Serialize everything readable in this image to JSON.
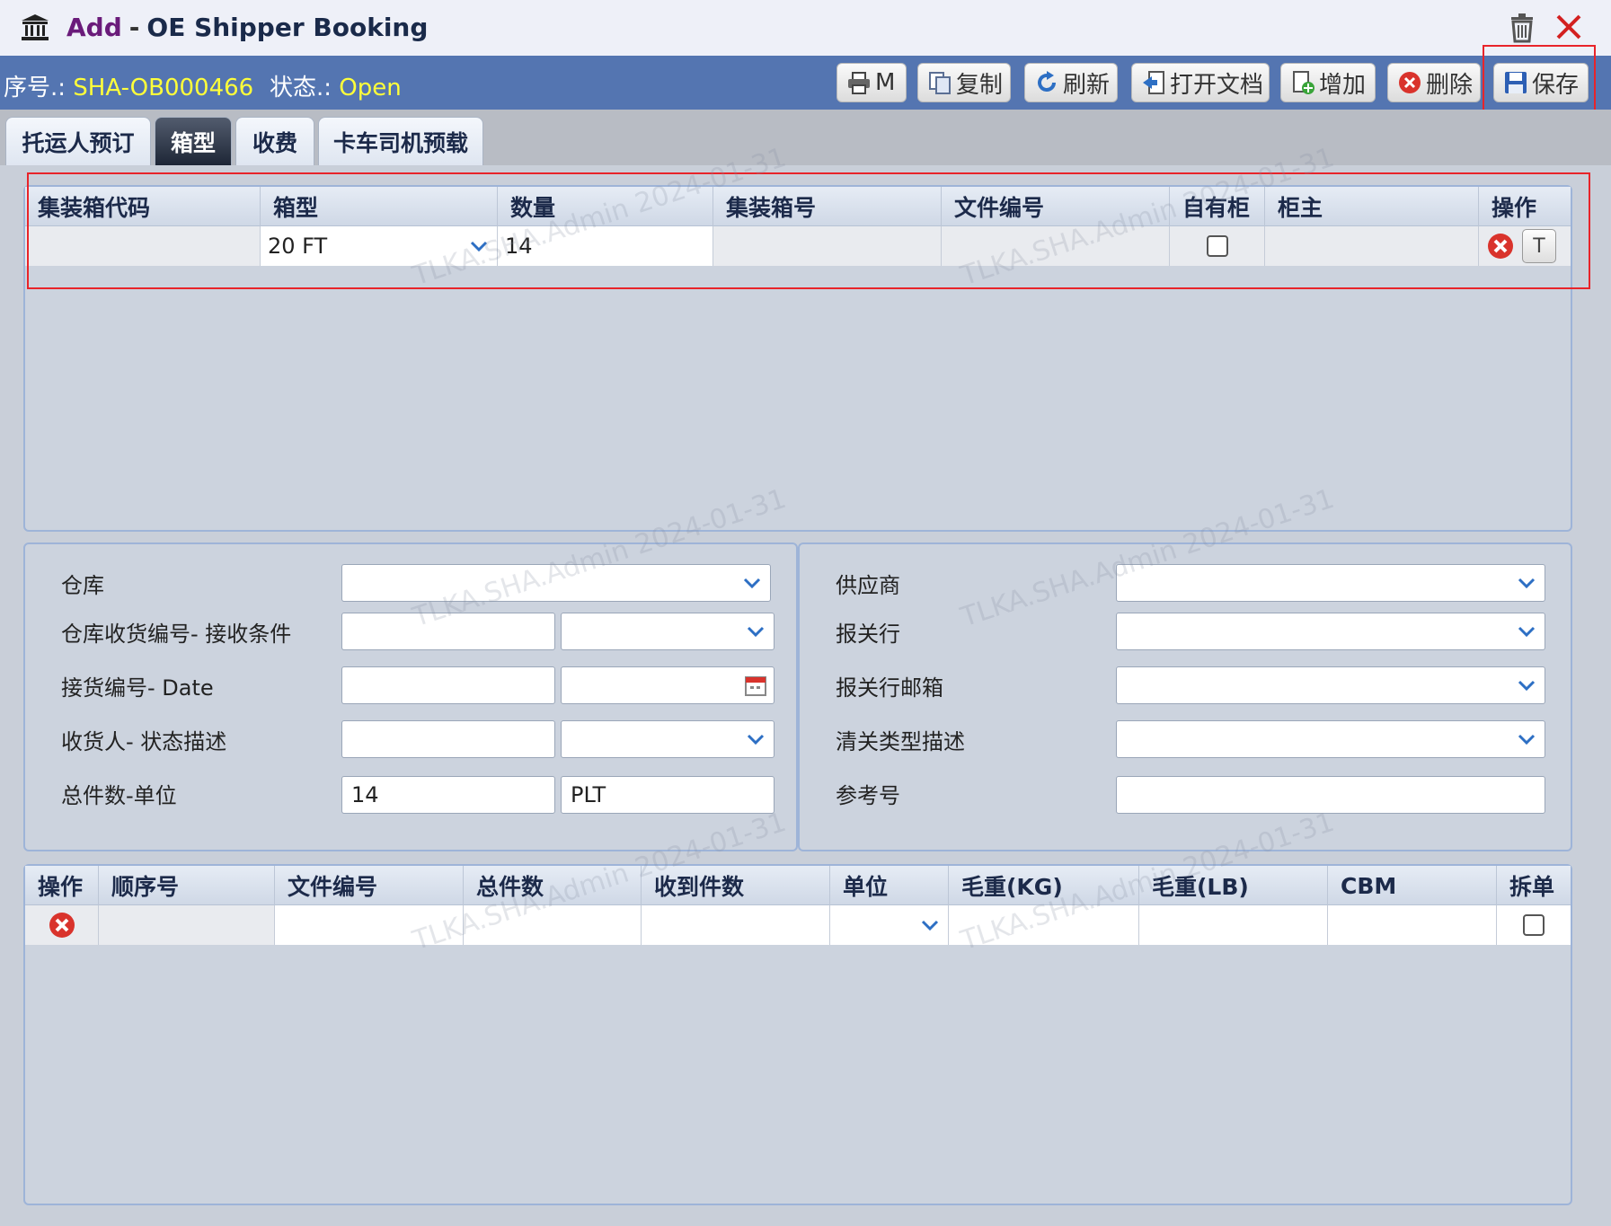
{
  "window": {
    "mode": "Add",
    "separator": "-",
    "title": "OE Shipper Booking"
  },
  "record": {
    "seq_label": "序号.:",
    "seq_value": "SHA-OB000466",
    "status_label": "状态.:",
    "status_value": "Open"
  },
  "toolbar": {
    "print_label": "M",
    "copy_label": "复制",
    "refresh_label": "刷新",
    "open_doc_label": "打开文档",
    "add_label": "增加",
    "delete_label": "删除",
    "save_label": "保存"
  },
  "tabs": [
    {
      "label": "托运人预订",
      "active": false
    },
    {
      "label": "箱型",
      "active": true
    },
    {
      "label": "收费",
      "active": false
    },
    {
      "label": "卡车司机预载",
      "active": false
    }
  ],
  "container_grid": {
    "columns": [
      "集装箱代码",
      "箱型",
      "数量",
      "集装箱号",
      "文件编号",
      "自有柜",
      "柜主",
      "操作"
    ],
    "rows": [
      {
        "container_code": "",
        "box_type": "20 FT",
        "quantity": "14",
        "container_no": "",
        "file_no": "",
        "own_container": false,
        "owner": "",
        "t_label": "T"
      }
    ]
  },
  "left_form": {
    "warehouse_label": "仓库",
    "warehouse_value": "",
    "receipt_label": "仓库收货编号- 接收条件",
    "receipt_no": "",
    "receipt_condition": "",
    "pickup_label": "接货编号- Date",
    "pickup_no": "",
    "pickup_date": "",
    "consignee_label": "收货人- 状态描述",
    "consignee": "",
    "status_desc": "",
    "total_label": "总件数-单位",
    "total_pieces": "14",
    "unit": "PLT"
  },
  "right_form": {
    "supplier_label": "供应商",
    "supplier_value": "",
    "broker_label": "报关行",
    "broker_value": "",
    "broker_email_label": "报关行邮箱",
    "broker_email_value": "",
    "clearance_label": "清关类型描述",
    "clearance_value": "",
    "ref_label": "参考号",
    "ref_value": ""
  },
  "cargo_grid": {
    "columns": [
      "操作",
      "顺序号",
      "文件编号",
      "总件数",
      "收到件数",
      "单位",
      "毛重(KG)",
      "毛重(LB)",
      "CBM",
      "拆单"
    ],
    "rows": [
      {
        "seq": "",
        "file_no": "",
        "total": "",
        "received": "",
        "unit": "",
        "gross_kg": "",
        "gross_lb": "",
        "cbm": "",
        "split": false
      }
    ]
  },
  "watermark_text": "TLKA.SHA.Admin 2024-01-31",
  "colors": {
    "toolbar_bg": "#5475b1",
    "status_yellow": "#ffff3a",
    "highlight_red": "#e8242a",
    "active_tab": "#2a3344"
  }
}
